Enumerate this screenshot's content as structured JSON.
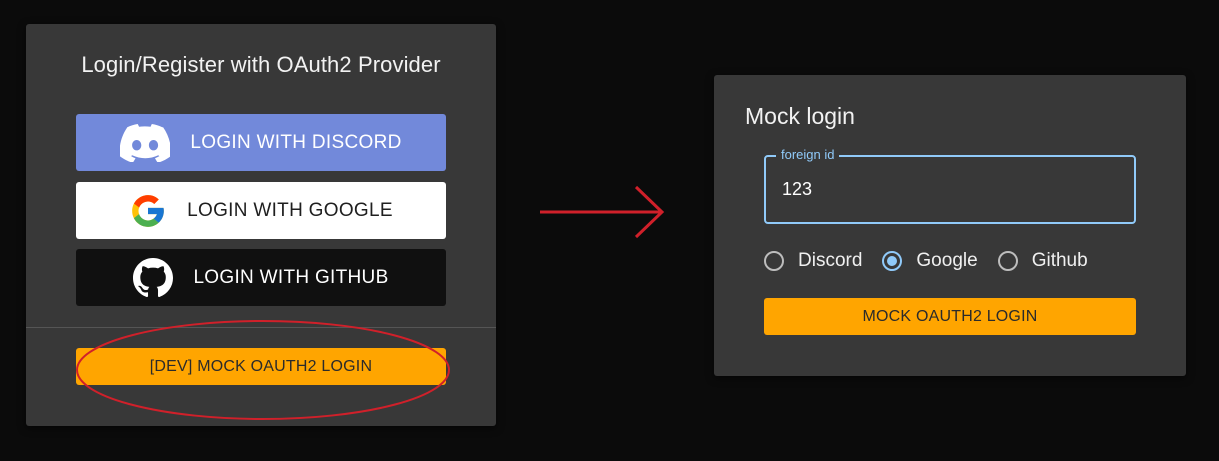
{
  "oauth_panel": {
    "title": "Login/Register with OAuth2 Provider",
    "discord_label": "LOGIN WITH DISCORD",
    "google_label": "LOGIN WITH GOOGLE",
    "github_label": "LOGIN WITH GITHUB",
    "mock_dev_label": "[DEV] MOCK OAUTH2 LOGIN",
    "icons": {
      "discord": "discord-icon",
      "google": "google-icon",
      "github": "github-icon"
    }
  },
  "annotations": {
    "ellipse_color": "#d0202a",
    "arrow_color": "#d0202a",
    "arrow": "arrow-right-icon"
  },
  "mock_login": {
    "title": "Mock login",
    "foreign_id": {
      "label": "foreign id",
      "value": "123"
    },
    "providers": [
      {
        "label": "Discord",
        "selected": false
      },
      {
        "label": "Google",
        "selected": true
      },
      {
        "label": "Github",
        "selected": false
      }
    ],
    "submit_label": "MOCK OAUTH2 LOGIN"
  },
  "colors": {
    "page_background": "#0b0b0b",
    "card_background": "#383838",
    "discord": "#7289da",
    "google_button": "#ffffff",
    "github_button": "#101010",
    "mock_button": "#ffa500",
    "accent": "#90caf9"
  }
}
